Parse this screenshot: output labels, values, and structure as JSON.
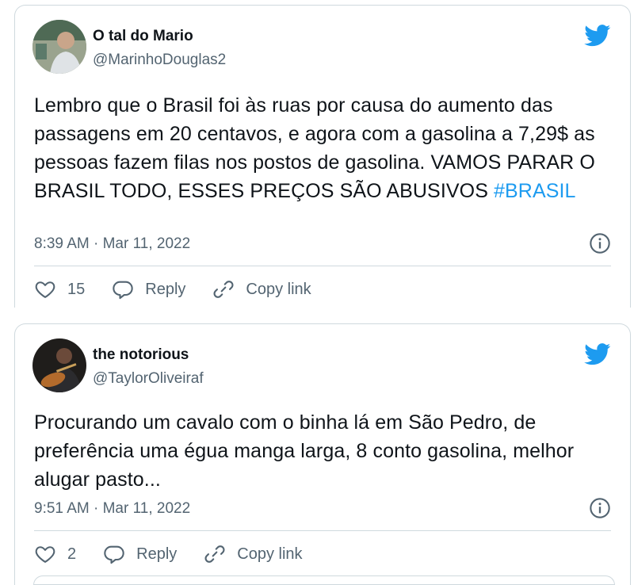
{
  "colors": {
    "brand": "#1d9bf0",
    "text": "#0f1419",
    "muted": "#536471",
    "border": "#cfd9de"
  },
  "tweets": [
    {
      "display_name": "O tal do Mario",
      "handle": "@MarinhoDouglas2",
      "text": "Lembro que o Brasil foi às ruas por causa do aumento das passagens em 20 centavos, e agora com a gasolina a 7,29$ as pessoas fazem filas nos postos de gasolina. VAMOS PARAR O BRASIL TODO, ESSES PREÇOS SÃO ABUSIVOS ",
      "hashtag": "#BRASIL",
      "timestamp": "8:39 AM · Mar 11, 2022",
      "likes": "15",
      "reply_label": "Reply",
      "copy_label": "Copy link",
      "icons": {
        "logo": "twitter-bird-icon",
        "info": "info-icon",
        "like": "heart-icon",
        "reply": "reply-bubble-icon",
        "copy": "link-icon"
      }
    },
    {
      "display_name": "the notorious",
      "handle": "@TaylorOliveiraf",
      "text": "Procurando um cavalo com o binha lá em São Pedro, de preferência uma égua manga larga, 8 conto gasolina, melhor alugar pasto...",
      "timestamp": "9:51 AM · Mar 11, 2022",
      "likes": "2",
      "reply_label": "Reply",
      "copy_label": "Copy link",
      "icons": {
        "logo": "twitter-bird-icon",
        "info": "info-icon",
        "like": "heart-icon",
        "reply": "reply-bubble-icon",
        "copy": "link-icon"
      }
    }
  ]
}
